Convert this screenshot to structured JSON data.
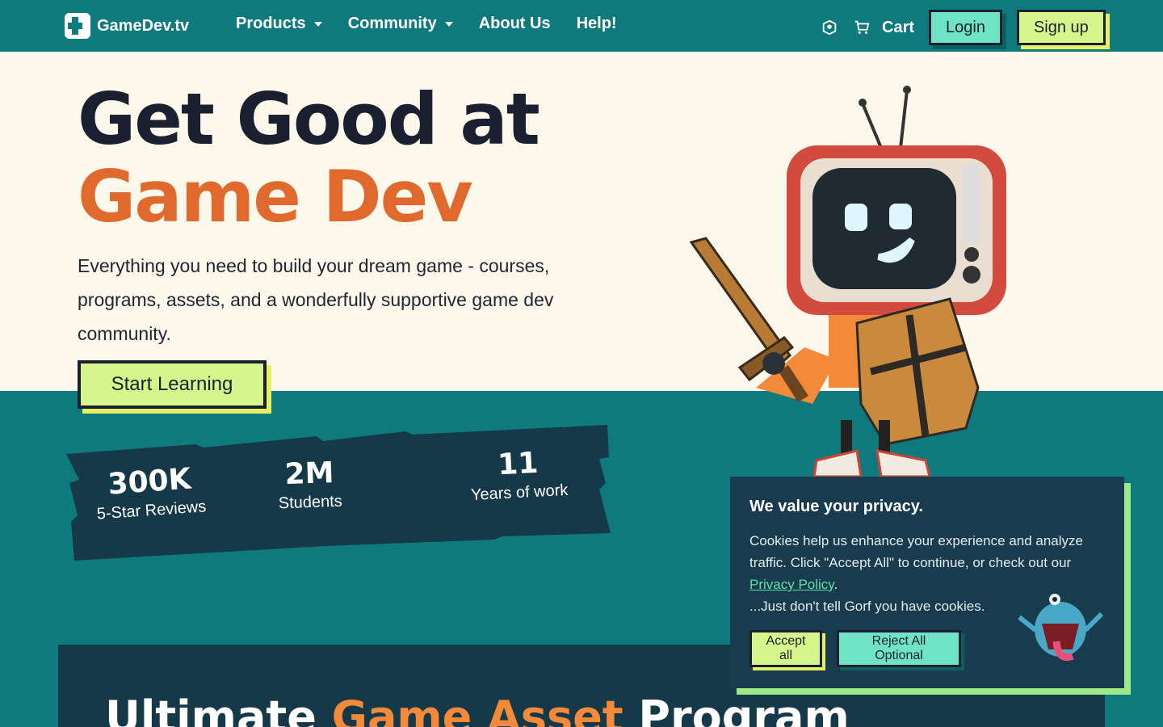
{
  "header": {
    "logo_text": "GameDev.tv",
    "nav": [
      "Products",
      "Community",
      "About Us",
      "Help!"
    ],
    "cart_label": "Cart",
    "login_label": "Login",
    "signup_label": "Sign up"
  },
  "hero": {
    "title_line1": "Get Good at",
    "title_line2": "Game Dev",
    "description": "Everything you need to build your dream game - courses, programs, assets, and a wonderfully supportive game dev community.",
    "cta_label": "Start Learning"
  },
  "stats": [
    {
      "value": "300K",
      "label": "5-Star Reviews"
    },
    {
      "value": "2M",
      "label": "Students"
    },
    {
      "value": "11",
      "label": "Years of work"
    }
  ],
  "promo": {
    "title_start": "Ultimate ",
    "title_accent": "Game Asset",
    "title_end": " Program"
  },
  "cookie": {
    "title": "We value your privacy.",
    "text1": "Cookies help us enhance your experience and analyze traffic. Click \"Accept All\" to continue, or check out our ",
    "link": "Privacy Policy",
    "text2": ".",
    "note": "...Just don't tell Gorf you have cookies.",
    "accept_label": "Accept all",
    "reject_label": "Reject All Optional"
  },
  "colors": {
    "teal": "#0e7a7d",
    "cream": "#fcf8ec",
    "orange": "#e06a2e",
    "lime": "#d6f58a",
    "mint": "#6fe3c6",
    "navy": "#16394a"
  }
}
